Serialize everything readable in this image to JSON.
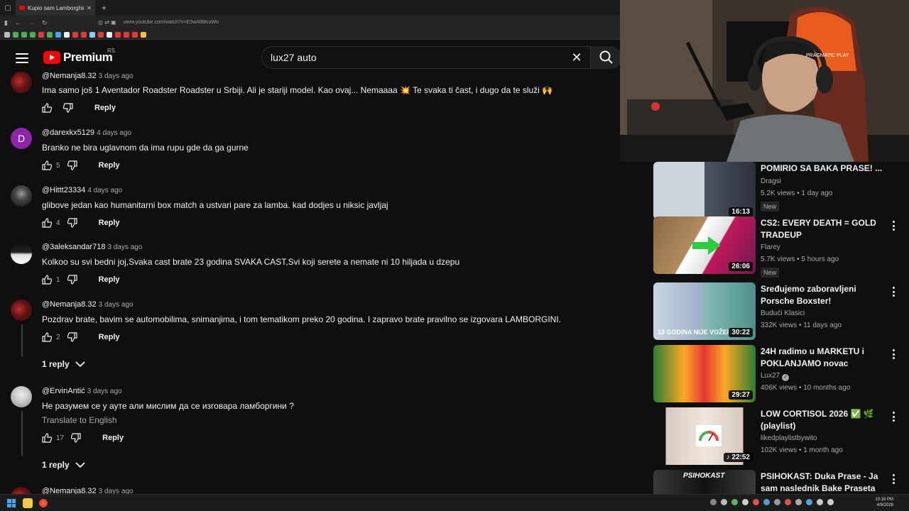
{
  "browser": {
    "tab_title": "Kupio sam Lamborghini Avente",
    "url": "www.youtube.com/watch?v=E3wAt88cvWo"
  },
  "header": {
    "logo_text": "Premium",
    "region": "RS",
    "search_value": "lux27 auto"
  },
  "comments": [
    {
      "author": "@Nemanja8.32",
      "date": "3 days ago",
      "text": "Ima samo još 1 Aventador Roadster Roadster u Srbiji. Ali je stariji model. Kao ovaj... Nemaaaa 💥 Te svaka ti čast, i dugo da te služi 🙌",
      "likes": "",
      "reply_label": "Reply"
    },
    {
      "author": "@darexkx5129",
      "date": "4 days ago",
      "text": "Branko ne bira uglavnom da ima rupu gde da ga gurne",
      "likes": "5",
      "reply_label": "Reply",
      "avatar_letter": "D"
    },
    {
      "author": "@Hittt23334",
      "date": "4 days ago",
      "text": "glibove jedan kao humanitarni box match a ustvari pare za lamba. kad dodjes u niksic javljaj",
      "likes": "4",
      "reply_label": "Reply"
    },
    {
      "author": "@3aleksandar718",
      "date": "3 days ago",
      "text": "Kolkoo su svi bedni joj,Svaka cast brate 23 godina SVAKA CAST,Svi koji serete a nemate ni 10 hiljada u dzepu",
      "likes": "1",
      "reply_label": "Reply"
    },
    {
      "author": "@Nemanja8.32",
      "date": "3 days ago",
      "text": "Pozdrav brate, bavim se automobilima, snimanjima, i tom tematikom preko 20 godina. I zapravo brate pravilno se izgovara LAMBORGINI.",
      "likes": "2",
      "reply_label": "Reply",
      "replies": "1 reply"
    },
    {
      "author": "@ErvinAntić",
      "date": "3 days ago",
      "text": "Не разумем се у ауте али мислим да се изговара ламборгини ?",
      "translate": "Translate to English",
      "likes": "17",
      "reply_label": "Reply",
      "replies": "1 reply"
    },
    {
      "author": "@Nemanja8.32",
      "date": "3 days ago"
    }
  ],
  "sidebar": {
    "videos": [
      {
        "title": "POMIRIO SA BAKA PRASE! ...",
        "channel": "Dragsi",
        "meta": "5.2K views • 1 day ago",
        "duration": "16:13",
        "badge": "New"
      },
      {
        "title": "CS2: EVERY DEATH = GOLD TRADEUP",
        "channel": "Flarey",
        "meta": "5.7K views • 5 hours ago",
        "duration": "26:06",
        "badge": "New"
      },
      {
        "title": "Sređujemo zaboravljeni Porsche Boxster!",
        "channel": "Budući Klasici",
        "meta": "332K views • 11 days ago",
        "duration": "30:22",
        "thumb_text": "13 GODINA  NIJE VOŽEN"
      },
      {
        "title": "24H radimo u MARKETU i POKLANJAMO novac",
        "channel": "Lux27",
        "meta": "406K views • 10 months ago",
        "duration": "29:27"
      },
      {
        "title": "LOW CORTISOL 2026 ✅ 🌿 (playlist)",
        "channel": "likedplaylistbywito",
        "meta": "102K views • 1 month ago",
        "duration": "22:52"
      },
      {
        "title": "PSIHOKAST: Duka Prase - Ja sam naslednik Bake Praseta",
        "thumb_text": "PSIHOKAST"
      }
    ]
  },
  "taskbar": {
    "time": "10:16 PM",
    "date": "4/9/2026"
  },
  "colors": {
    "background": "#0f0f0f",
    "youtube_red": "#ff0000",
    "text_primary": "#f1f1f1",
    "text_secondary": "#aaaaaa"
  }
}
